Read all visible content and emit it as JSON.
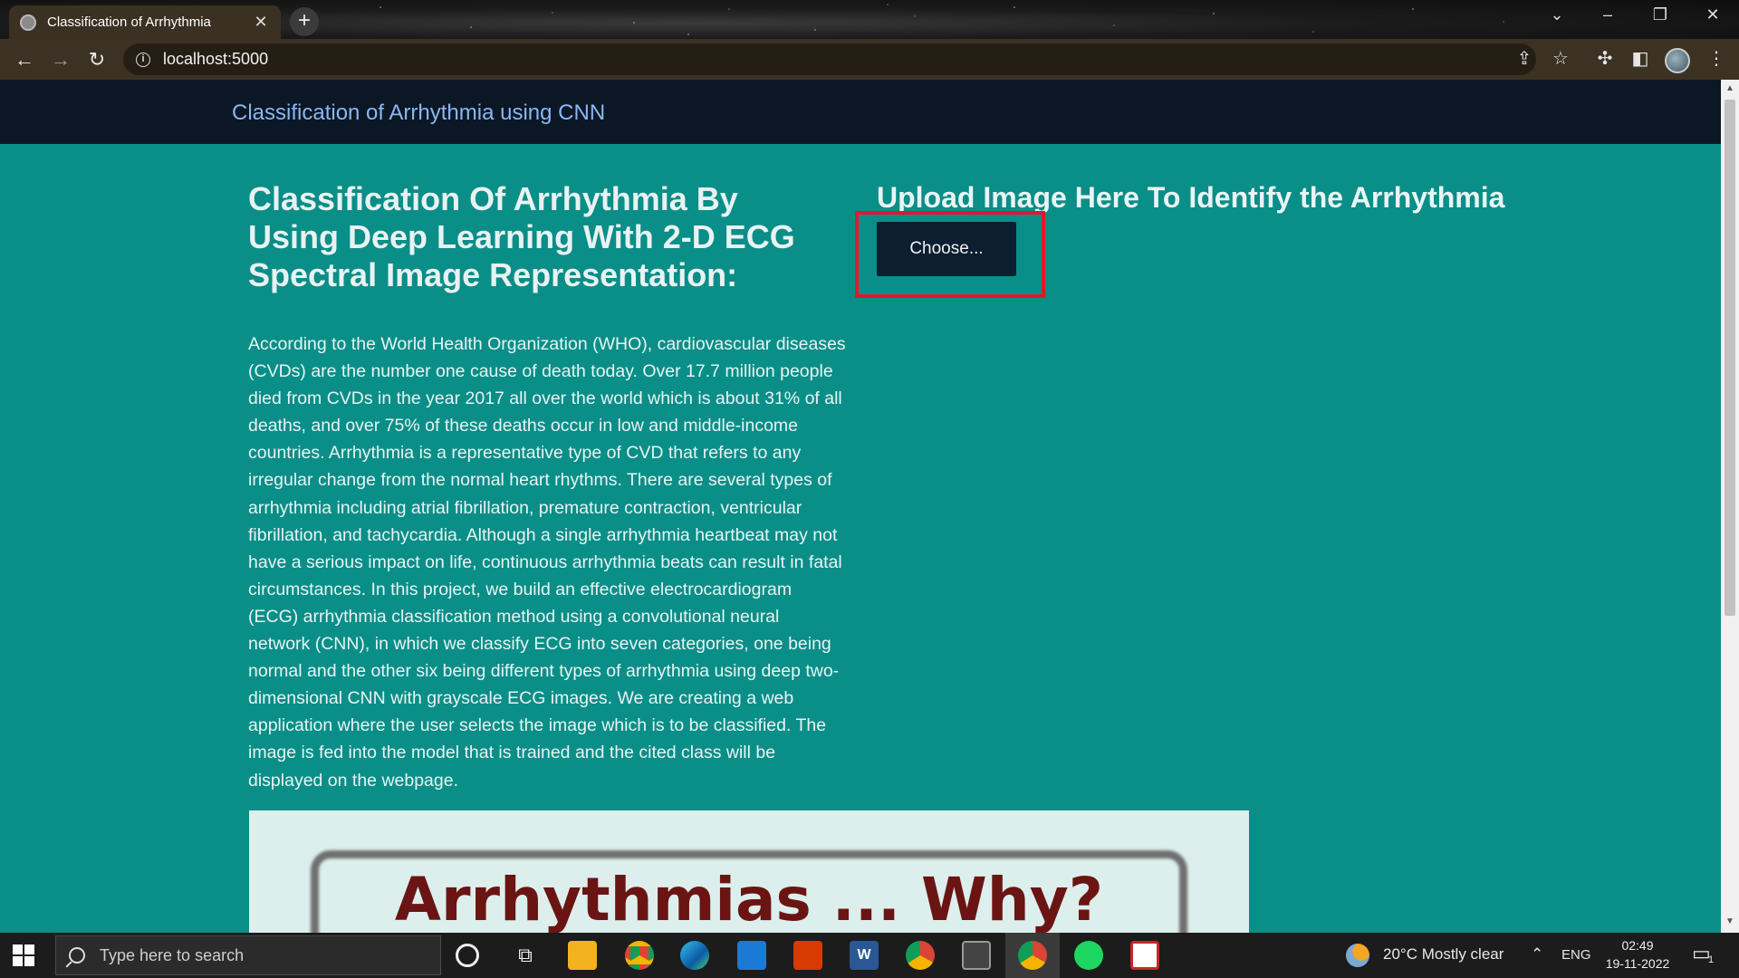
{
  "browser": {
    "tab_title": "Classification of Arrhythmia",
    "tab_close": "✕",
    "new_tab": "+",
    "url": "localhost:5000"
  },
  "page": {
    "brand": "Classification of Arrhythmia using CNN",
    "heading": "Classification Of Arrhythmia By Using Deep Learning With 2-D ECG Spectral Image Representation:",
    "description": "According to the World Health Organization (WHO), cardiovascular diseases (CVDs) are the number one cause of death today. Over 17.7 million people died from CVDs in the year 2017 all over the world which is about 31% of all deaths, and over 75% of these deaths occur in low and middle-income countries. Arrhythmia is a representative type of CVD that refers to any irregular change from the normal heart rhythms. There are several types of arrhythmia including atrial fibrillation, premature contraction, ventricular fibrillation, and tachycardia. Although a single arrhythmia heartbeat may not have a serious impact on life, continuous arrhythmia beats can result in fatal circumstances. In this project, we build an effective electrocardiogram (ECG) arrhythmia classification method using a convolutional neural network (CNN), in which we classify ECG into seven categories, one being normal and the other six being different types of arrhythmia using deep two-dimensional CNN with grayscale ECG images. We are creating a web application where the user selects the image which is to be classified. The image is fed into the model that is trained and the cited class will be displayed on the webpage.",
    "upload_title": "Upload Image Here To Identify the Arrhythmia",
    "choose_button": "Choose...",
    "banner_text": "Arrhythmias ... Why?"
  },
  "taskbar": {
    "search_placeholder": "Type here to search",
    "weather": "20°C  Mostly clear",
    "language": "ENG",
    "time": "02:49",
    "date": "19-11-2022",
    "notification_count": "1"
  },
  "colors": {
    "page_background": "#0a8e88",
    "navbar": "#0c1726",
    "brand_text": "#8ab7f0",
    "button": "#0c1e30",
    "highlight": "#e0182c",
    "banner_text": "#6b1414"
  }
}
